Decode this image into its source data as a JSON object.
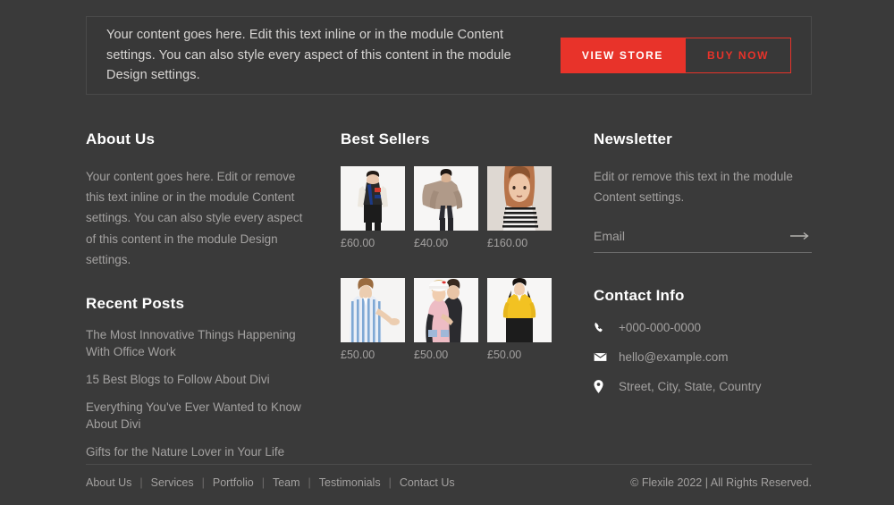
{
  "theme": {
    "page_bg": "#3a3a3a",
    "panel_bg": "#383838",
    "accent": "#e8332a",
    "heading_color": "#ffffff",
    "body_color": "#a3a1a0"
  },
  "cta_banner": {
    "text": "Your content goes here. Edit this text inline or in the module Content settings. You can also style every aspect of this content in the module Design settings.",
    "primary_button": "VIEW STORE",
    "secondary_button": "BUY NOW"
  },
  "about": {
    "title": "About Us",
    "body": "Your content goes here. Edit or remove this text inline or in the module Content settings. You can also style every aspect of this content in the module Design settings.",
    "recent_title": "Recent Posts",
    "posts": [
      "The Most Innovative Things Happening With Office Work",
      "15 Best Blogs to Follow About Divi",
      "Everything You've Ever Wanted to Know About Divi",
      "Gifts for the Nature Lover in Your Life"
    ]
  },
  "best_sellers": {
    "title": "Best Sellers",
    "products": [
      {
        "price": "£60.00",
        "alt": "woman-in-striped-colorblock-jacket"
      },
      {
        "price": "£40.00",
        "alt": "woman-in-beige-ruffle-blouse"
      },
      {
        "price": "£160.00",
        "alt": "woman-in-black-white-striped-top"
      },
      {
        "price": "£50.00",
        "alt": "woman-in-blue-striped-shirt"
      },
      {
        "price": "£50.00",
        "alt": "two-women-in-pink-outerwear"
      },
      {
        "price": "£50.00",
        "alt": "woman-in-yellow-blouse"
      }
    ]
  },
  "newsletter": {
    "title": "Newsletter",
    "body": "Edit or remove this text in the module Content settings.",
    "email_placeholder": "Email",
    "email_value": "",
    "submit_icon": "arrow-right-icon"
  },
  "contact": {
    "title": "Contact Info",
    "items": [
      {
        "icon": "phone-icon",
        "text": "+000-000-0000"
      },
      {
        "icon": "envelope-icon",
        "text": "hello@example.com"
      },
      {
        "icon": "map-pin-icon",
        "text": "Street, City, State, Country"
      }
    ]
  },
  "footer": {
    "links": [
      "About Us",
      "Services",
      "Portfolio",
      "Team",
      "Testimonials",
      "Contact Us"
    ],
    "separator": "|",
    "copyright": "© Flexile 2022 | All Rights Reserved."
  }
}
